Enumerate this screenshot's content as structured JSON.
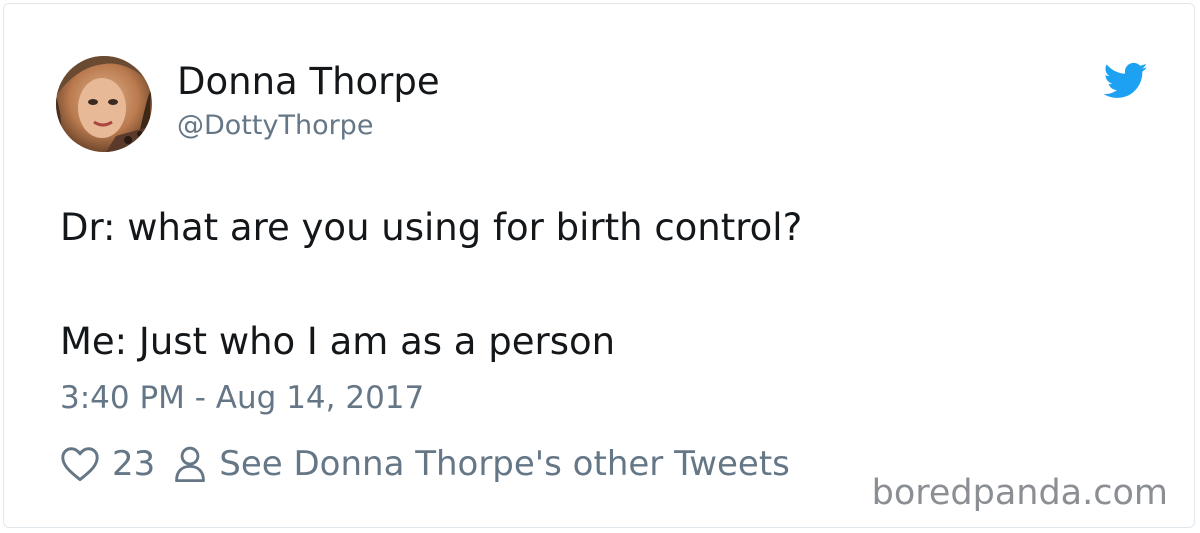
{
  "tweet": {
    "display_name": "Donna Thorpe",
    "handle": "@DottyThorpe",
    "text_line1": "Dr: what are you using for birth control?",
    "text_line2": "Me: Just who I am as a person",
    "timestamp": "3:40 PM - Aug 14, 2017",
    "like_count": "23",
    "see_other_label": "See Donna Thorpe's other Tweets"
  },
  "watermark": "boredpanda.com",
  "icons": {
    "logo": "twitter-bird-icon",
    "like": "heart-icon",
    "profile": "person-icon"
  },
  "colors": {
    "twitter_blue": "#1da1f2",
    "text_primary": "#14171a",
    "text_secondary": "#657786",
    "border": "#e1e8ed"
  }
}
